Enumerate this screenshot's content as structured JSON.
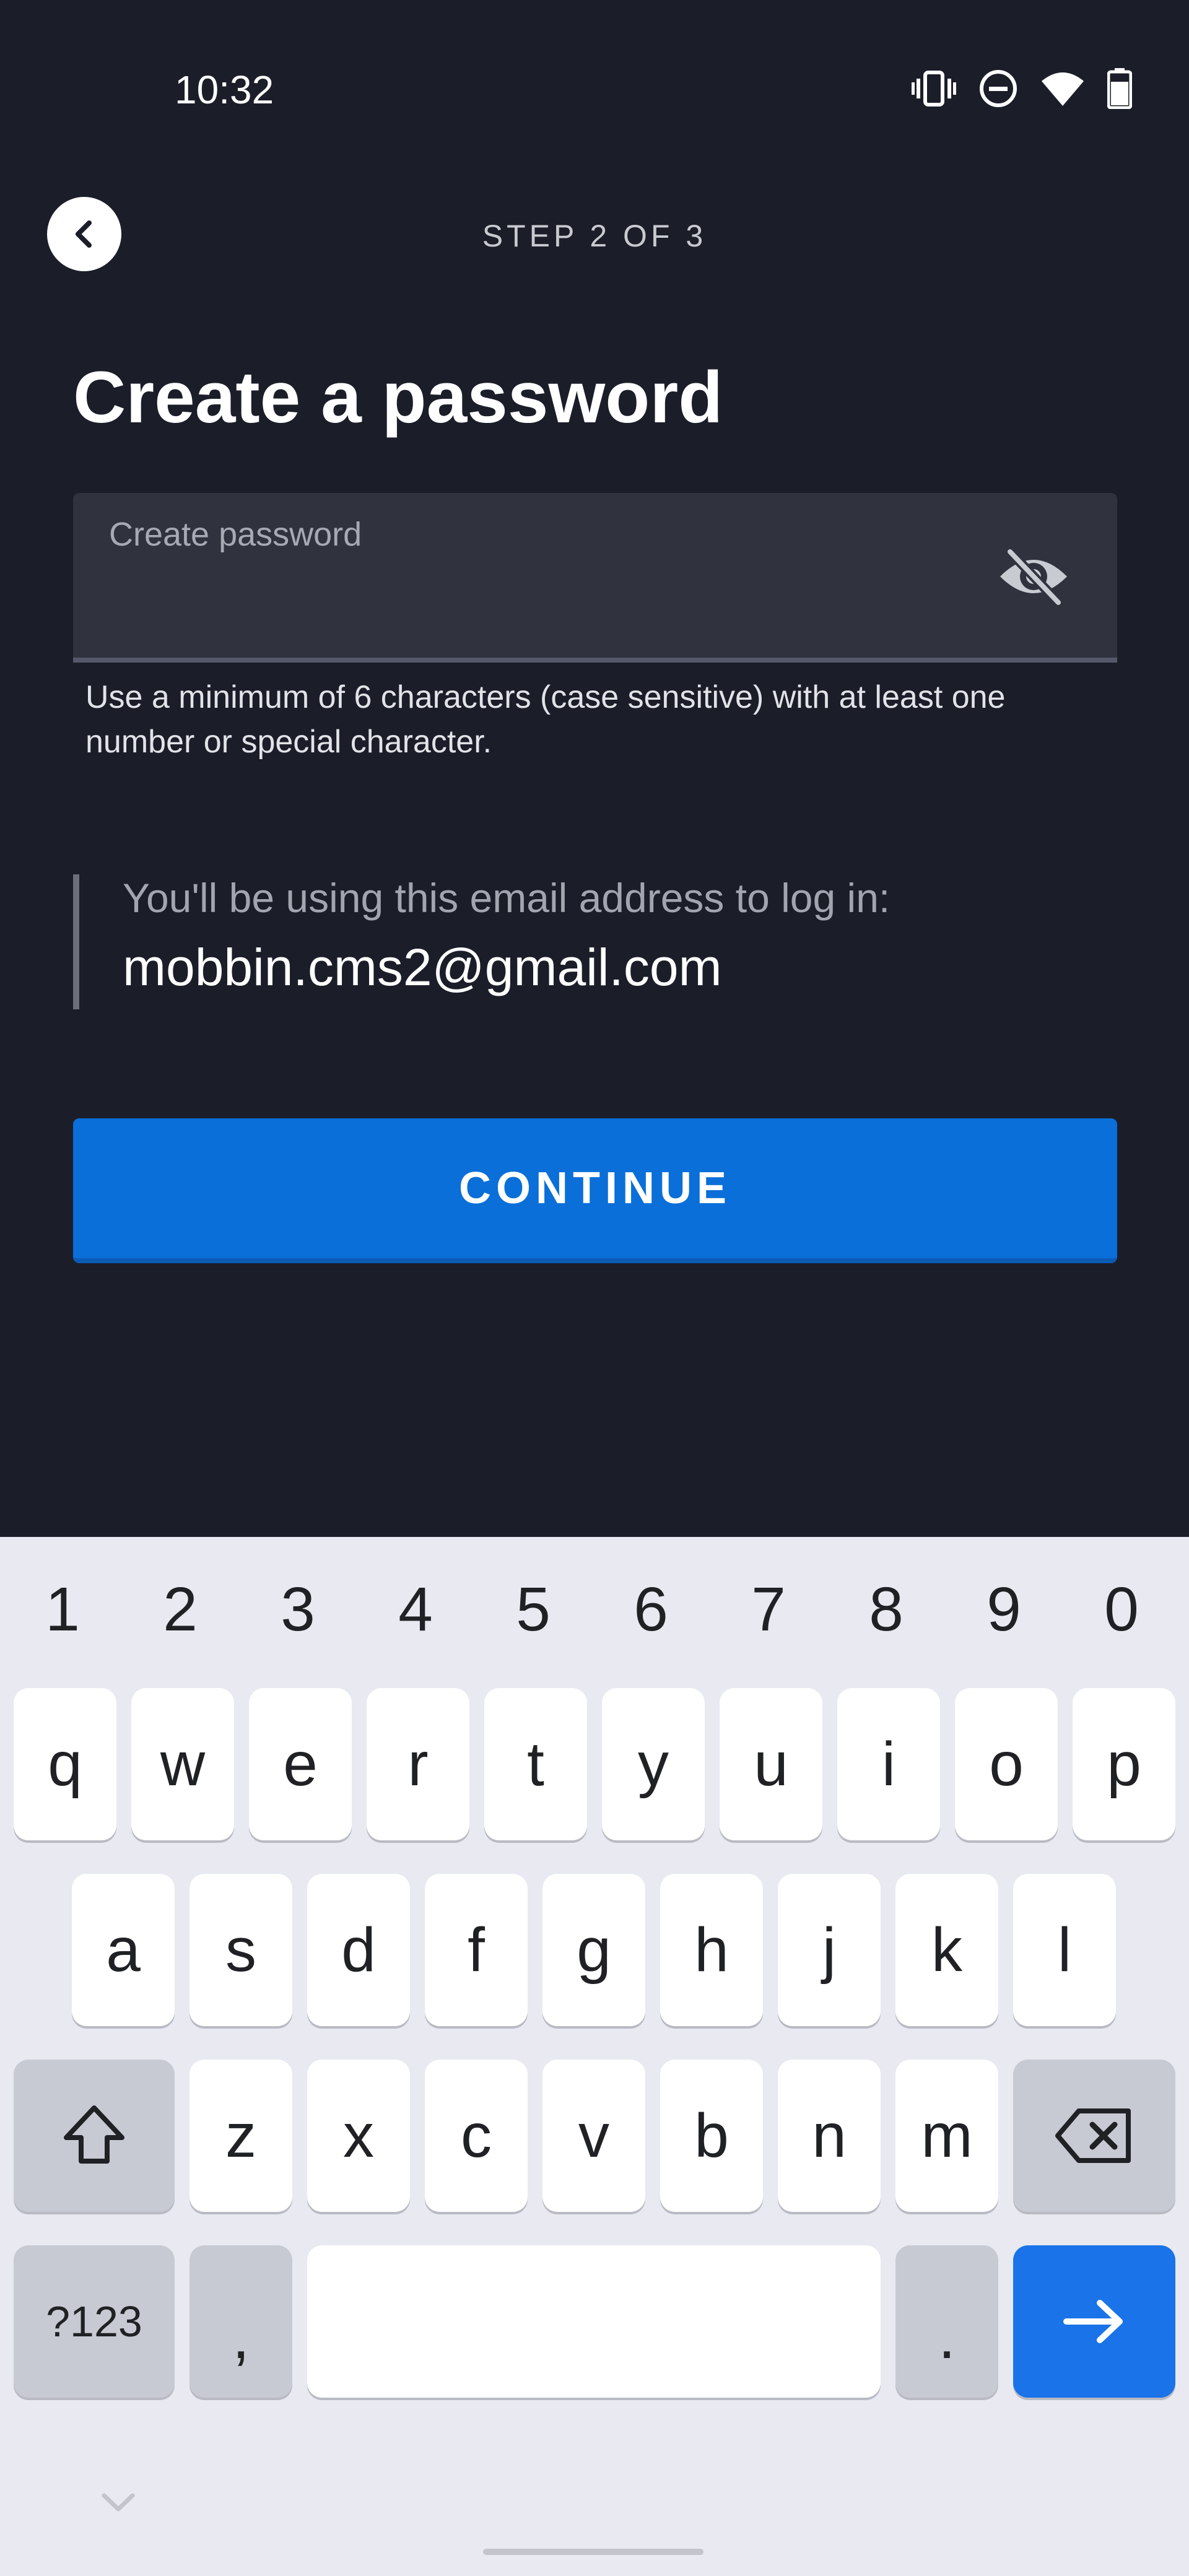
{
  "status_bar": {
    "time": "10:32",
    "icons": [
      "vibrate-icon",
      "do-not-disturb-icon",
      "wifi-icon",
      "battery-icon"
    ]
  },
  "header": {
    "back_icon": "chevron-left-icon",
    "step": "STEP 2 OF 3"
  },
  "title": "Create a password",
  "password_field": {
    "placeholder": "Create password",
    "value": "",
    "toggle_icon": "eye-off-icon",
    "hint": "Use a minimum of 6 characters (case sensitive) with at least one number or special character."
  },
  "email_info": {
    "intro": "You'll be using this email address to log in:",
    "email": "mobbin.cms2@gmail.com"
  },
  "continue_label": "CONTINUE",
  "colors": {
    "background": "#1b1d29",
    "field": "#30323e",
    "accent": "#0a6fd8",
    "keyboard": "#e8e9f1"
  },
  "keyboard": {
    "numbers": [
      "1",
      "2",
      "3",
      "4",
      "5",
      "6",
      "7",
      "8",
      "9",
      "0"
    ],
    "row1": [
      "q",
      "w",
      "e",
      "r",
      "t",
      "y",
      "u",
      "i",
      "o",
      "p"
    ],
    "row2": [
      "a",
      "s",
      "d",
      "f",
      "g",
      "h",
      "j",
      "k",
      "l"
    ],
    "row3": [
      "z",
      "x",
      "c",
      "v",
      "b",
      "n",
      "m"
    ],
    "symbols_label": "?123",
    "comma": ",",
    "period": ".",
    "shift_icon": "shift-icon",
    "backspace_icon": "backspace-icon",
    "enter_icon": "arrow-right-icon",
    "collapse_icon": "chevron-down-icon"
  }
}
